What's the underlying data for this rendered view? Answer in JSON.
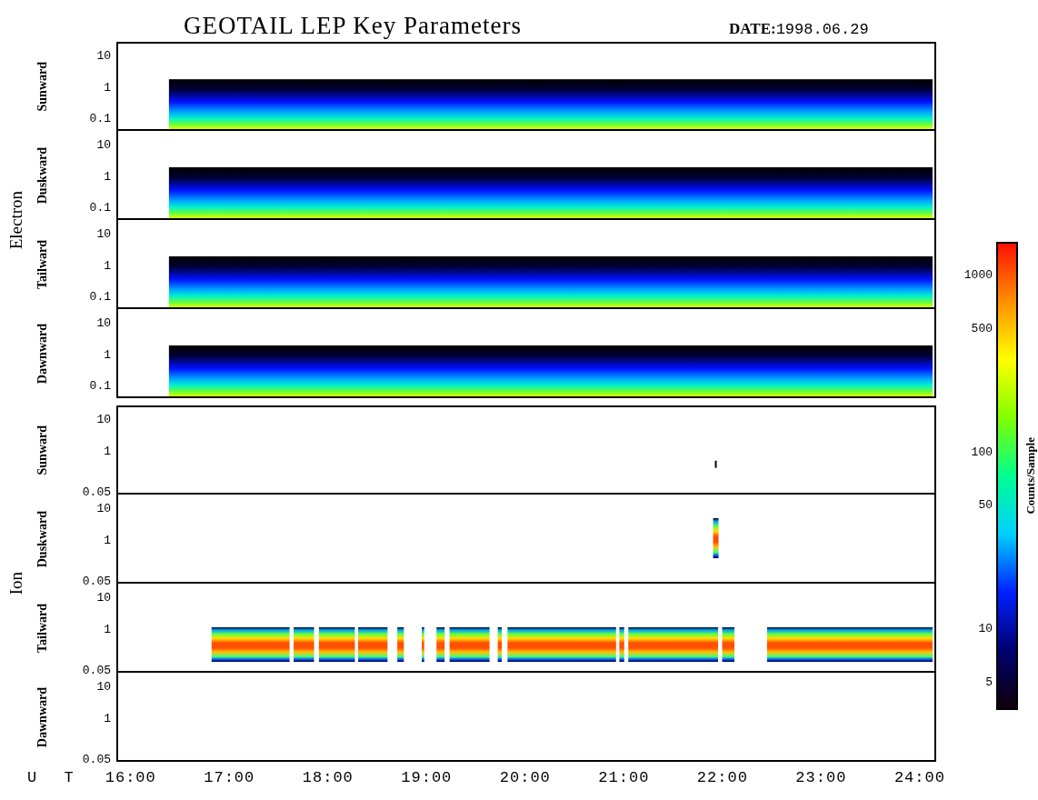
{
  "title": "GEOTAIL LEP Key Parameters",
  "date": {
    "label": "DATE:",
    "value": "1998.06.29"
  },
  "groups": [
    {
      "name": "Electron",
      "panels": [
        {
          "direction": "Sunward",
          "kind": "electron",
          "y_ticks": [
            "10",
            "1",
            "0.1"
          ]
        },
        {
          "direction": "Duskward",
          "kind": "electron",
          "y_ticks": [
            "10",
            "1",
            "0.1"
          ]
        },
        {
          "direction": "Tailward",
          "kind": "electron",
          "y_ticks": [
            "10",
            "1",
            "0.1"
          ]
        },
        {
          "direction": "Dawnward",
          "kind": "electron",
          "y_ticks": [
            "10",
            "1",
            "0.1"
          ]
        }
      ]
    },
    {
      "name": "Ion",
      "panels": [
        {
          "direction": "Sunward",
          "kind": "dot",
          "y_ticks": [
            "10",
            "1",
            "0.05"
          ]
        },
        {
          "direction": "Duskward",
          "kind": "blip",
          "y_ticks": [
            "10",
            "1",
            "0.05"
          ]
        },
        {
          "direction": "Tailward",
          "kind": "band",
          "y_ticks": [
            "10",
            "1",
            "0.05"
          ]
        },
        {
          "direction": "Dawnward",
          "kind": "empty",
          "y_ticks": [
            "10",
            "1",
            "0.05"
          ]
        }
      ]
    }
  ],
  "x_axis": {
    "label": "U T",
    "ticks": [
      "16:00",
      "17:00",
      "18:00",
      "19:00",
      "20:00",
      "21:00",
      "22:00",
      "23:00",
      "24:00"
    ]
  },
  "colorbar": {
    "label": "Counts/Sample",
    "ticks": [
      "1000",
      "500",
      "100",
      "50",
      "10",
      "5"
    ]
  }
}
